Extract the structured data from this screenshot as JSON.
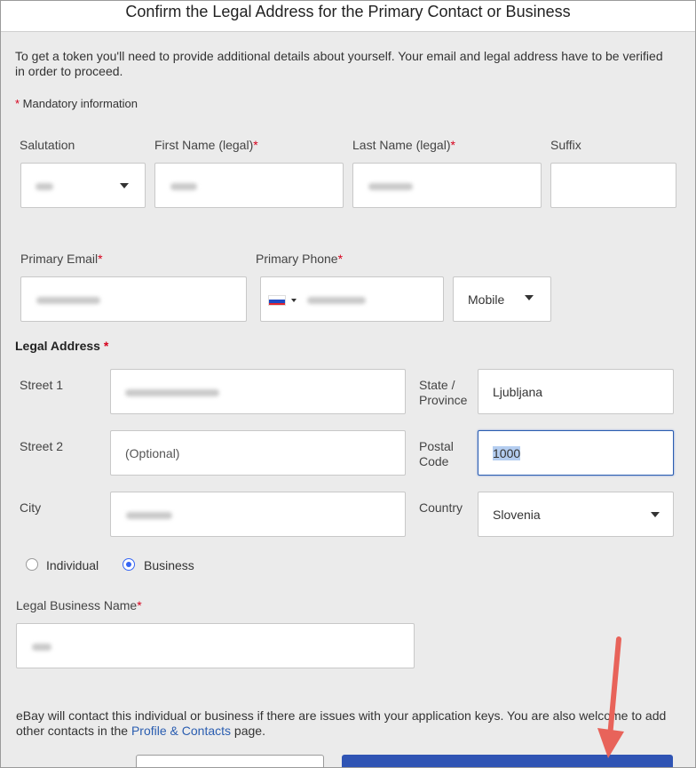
{
  "dialog": {
    "title": "Confirm the Legal Address for the Primary Contact or Business",
    "intro": "To get a token you'll need to provide additional details about yourself. Your email and legal address have to be verified in order to proceed.",
    "mandatory_marker": "*",
    "mandatory_note": " Mandatory information"
  },
  "name_row": {
    "salutation_label": "Salutation",
    "first_name_label": "First Name (legal)",
    "last_name_label": "Last Name (legal)",
    "suffix_label": "Suffix",
    "required_marker": "*"
  },
  "contact_row": {
    "email_label": "Primary Email",
    "phone_label": "Primary Phone",
    "phone_type_value": "Mobile",
    "required_marker": "*"
  },
  "legal_address": {
    "heading": "Legal Address",
    "required_marker": "*",
    "street1_label": "Street 1",
    "street2_label": "Street 2",
    "street2_placeholder": "(Optional)",
    "city_label": "City",
    "state_label_line1": "State /",
    "state_label_line2": "Province",
    "state_value": "Ljubljana",
    "postal_label_line1": "Postal",
    "postal_label_line2": "Code",
    "postal_value": "1000",
    "country_label": "Country",
    "country_value": "Slovenia"
  },
  "entity_type": {
    "individual_label": "Individual",
    "business_label": "Business",
    "selected": "Business"
  },
  "business": {
    "name_label": "Legal Business Name",
    "required_marker": "*"
  },
  "footer": {
    "notice_before_link": "eBay will contact this individual or business if there are issues with your application keys. You are also welcome to add other contacts in the ",
    "link_text": "Profile & Contacts",
    "notice_after_link": " page."
  },
  "colors": {
    "accent": "#3665f3",
    "required": "#d6001c",
    "link": "#2a5db0",
    "annotation_arrow": "#e8635a",
    "primary_button": "#2f54b4"
  }
}
